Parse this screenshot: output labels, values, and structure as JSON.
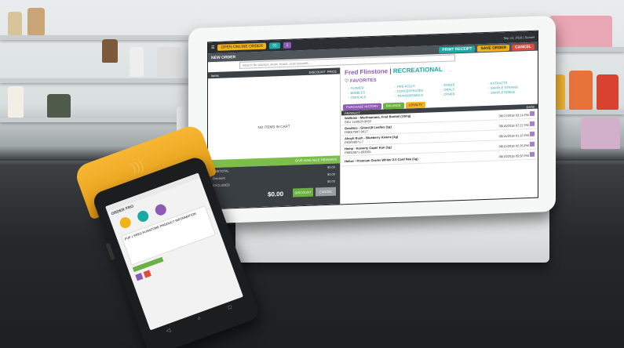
{
  "tablet": {
    "topbar": {
      "open_pos": "OPEN ONLINE ORDER",
      "badge_a": "31",
      "badge_b": "1",
      "right_text": "Sep 13, 2018 | Sunset"
    },
    "header": {
      "title": "NEW ORDER",
      "print_receipt": "PRINT RECEIPT",
      "save_order": "SAVE ORDER",
      "cancel": "CANCEL"
    },
    "search_placeholder": "Search for product, strain, brand, scan barcode...",
    "cart": {
      "col_items": "Items",
      "col_discount": "DISCOUNT",
      "col_price": "PRICE",
      "empty_text": "NO ITEMS IN CART",
      "apply_banner": "GIVE AVAILABLE REWARDS",
      "subtotal_label": "SUBTOTAL",
      "subtotal_value": "$0.00",
      "discount_label": "Discount",
      "discount_value": "$0.00",
      "tax_label": "EXCLUDED",
      "tax_value": "$0.00",
      "total": "$0.00",
      "discount_btn": "DISCOUNT",
      "cancel_btn": "CANCEL"
    },
    "customer": {
      "first": "Fred Flinstone",
      "sep": " | ",
      "type": "RECREATIONAL"
    },
    "favorites_title": "FAVORITES",
    "favorites": [
      "FLOWER",
      "PRE-ROLLS",
      "EDIBLE",
      "EXTRACTS",
      "BUBBLES",
      "CONCENTRATES",
      "ORALS",
      "SAMPLE STRAINS",
      "TOPICALS",
      "TRANSDERMALS",
      "OTHER",
      "SAMPLE EDIBLE"
    ],
    "tabs": [
      "PURCHASE HISTORY",
      "BALANCE",
      "LOYALTY"
    ],
    "products_header": {
      "col1": "PRODUCT",
      "col2": "DATE"
    },
    "products": [
      {
        "name": "Wellbine - Marihuanana, Fred Bunbel (10mg)",
        "sub": "SKU 14/0820-9832",
        "date": "06/17/2018 03:14 PM"
      },
      {
        "name": "Gorditos - Gloud (8 Leafies (1g)",
        "sub": "P883/7897-9917",
        "date": "06/16/2018 07:22 PM"
      },
      {
        "name": "Ahoyh Rush - Blueberry Kwene (1g)",
        "sub": "P83/0/8071-7",
        "date": "06/14/2018 01:10 PM"
      },
      {
        "name": "Hemp - Kewerty Caper Kan (1g)",
        "sub": "P883/4871-803001",
        "date": "06/12/2018 02:35 PM"
      },
      {
        "name": "Helixe - Premium Grams Whiter 2.0 Card Nee (1g)",
        "sub": "",
        "date": "06/10/2018 05:50 PM"
      }
    ]
  },
  "handheld": {
    "title": "ORDER FRO",
    "card_text": "PVP 1 FRED FLINSTONE PRODUCT INFORMATION",
    "nav": [
      "◁",
      "○",
      "□"
    ]
  }
}
